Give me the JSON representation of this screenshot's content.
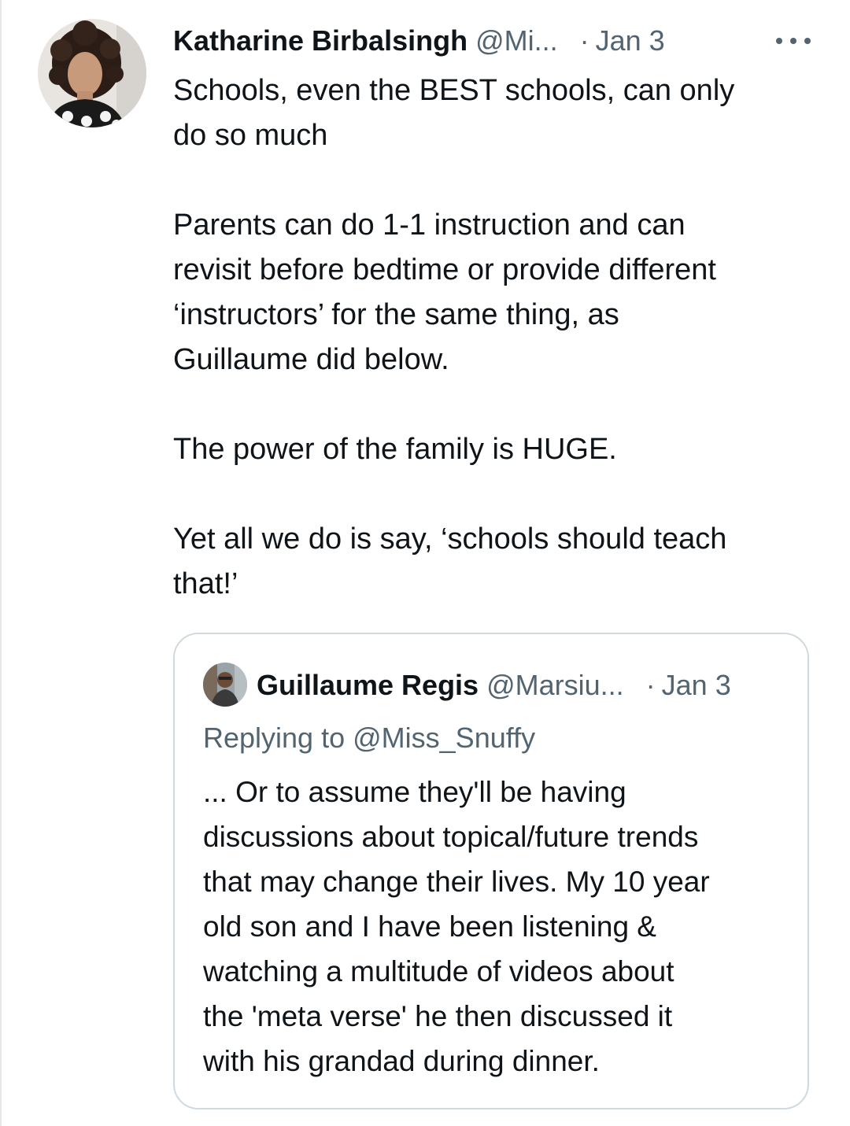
{
  "tweet": {
    "display_name": "Katharine Birbalsingh",
    "handle": "@Mi...",
    "separator": "·",
    "date": "Jan 3",
    "lines": [
      "Schools, even the BEST schools, can only",
      "do so much",
      "",
      "Parents can do 1-1 instruction and can",
      "revisit before bedtime or provide different",
      "‘instructors’ for the same thing, as",
      "Guillaume did below.",
      "",
      "The power of the family is HUGE.",
      "",
      "Yet all we do is say, ‘schools should teach",
      "that!’"
    ]
  },
  "quoted": {
    "display_name": "Guillaume Regis",
    "handle": "@Marsiu...",
    "separator": "·",
    "date": "Jan 3",
    "replying_prefix": "Replying to",
    "replying_mention": "@Miss_Snuffy",
    "lines": [
      "... Or to assume they'll be having",
      "discussions about topical/future trends",
      "that may change their lives. My 10 year",
      "old son and I have been listening &",
      "watching a multitude of videos about",
      "the 'meta verse' he then discussed it",
      "with his grandad during dinner."
    ]
  },
  "icons": {
    "more": "more-horizontal-icon"
  },
  "colors": {
    "text_primary": "#0f1419",
    "text_secondary": "#536471",
    "border": "#cfd9de"
  }
}
